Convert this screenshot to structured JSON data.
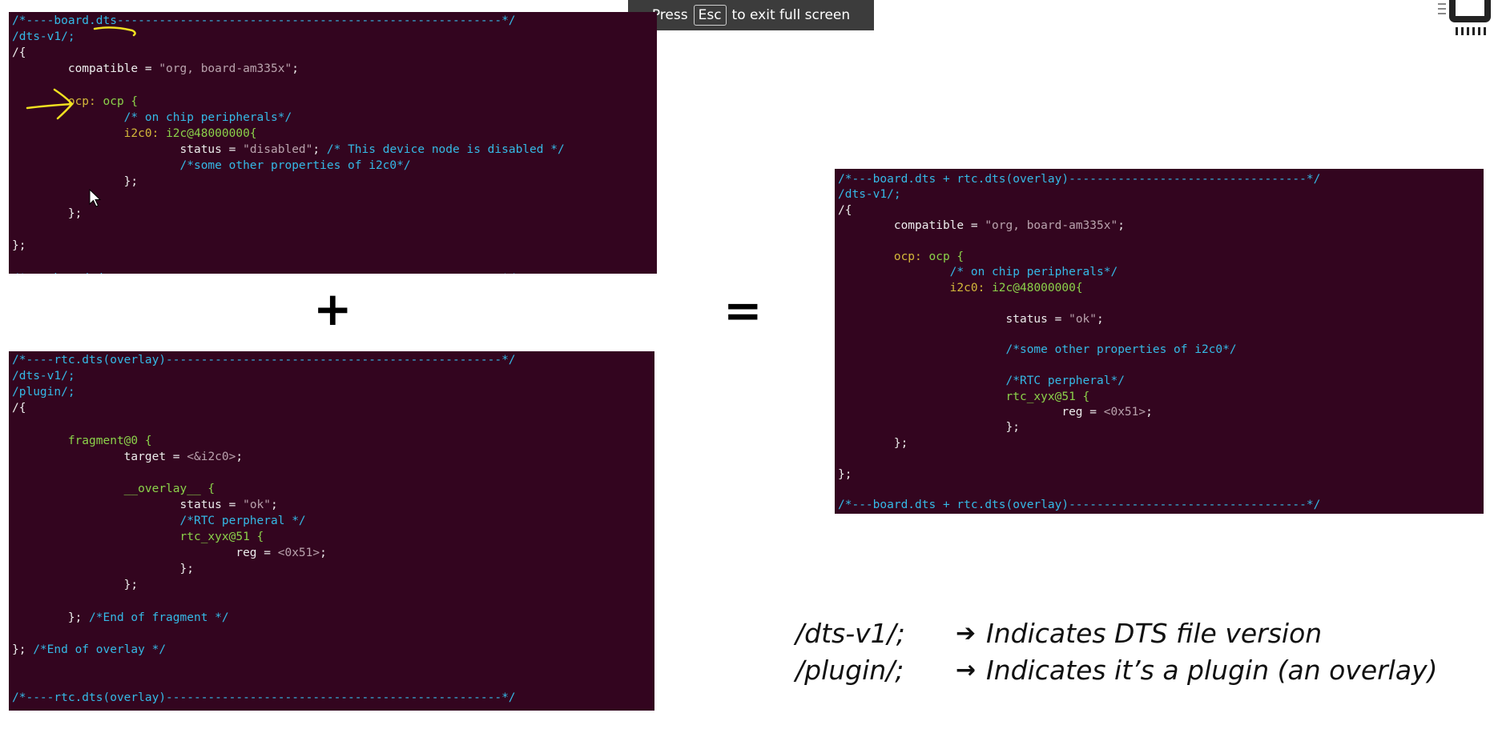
{
  "fullscreen_banner": {
    "press": "Press",
    "key": "Esc",
    "message": "to exit full screen"
  },
  "operators": {
    "plus": "+",
    "equals": "="
  },
  "board_dts": {
    "lines": [
      [
        {
          "t": "/*----board.dts-------------------------------------------------------*/",
          "c": "c"
        }
      ],
      [
        {
          "t": "/dts-v1/;",
          "c": "c"
        }
      ],
      [
        {
          "t": "/{",
          "c": "w"
        }
      ],
      [
        {
          "t": "        compatible = ",
          "c": "w"
        },
        {
          "t": "\"org, board-am335x\"",
          "c": "s"
        },
        {
          "t": ";",
          "c": "w"
        }
      ],
      [],
      [
        {
          "t": "        ocp: ",
          "c": "k"
        },
        {
          "t": "ocp {",
          "c": "g"
        }
      ],
      [
        {
          "t": "                /* on chip peripherals*/",
          "c": "c"
        }
      ],
      [
        {
          "t": "                i2c0: ",
          "c": "k"
        },
        {
          "t": "i2c@48000000{",
          "c": "g"
        }
      ],
      [
        {
          "t": "                        status = ",
          "c": "w"
        },
        {
          "t": "\"disabled\"",
          "c": "s"
        },
        {
          "t": "; ",
          "c": "w"
        },
        {
          "t": "/* This device node is disabled */",
          "c": "c"
        }
      ],
      [
        {
          "t": "                        /*some other properties of i2c0*/",
          "c": "c"
        }
      ],
      [
        {
          "t": "                };",
          "c": "w"
        }
      ],
      [],
      [
        {
          "t": "        };",
          "c": "w"
        }
      ],
      [],
      [
        {
          "t": "};",
          "c": "w"
        }
      ],
      [],
      [
        {
          "t": "/*----board.dts-------------------------------------------------------*/",
          "c": "c"
        }
      ]
    ]
  },
  "rtc_dts": {
    "lines": [
      [
        {
          "t": "/*----rtc.dts(overlay)------------------------------------------------*/",
          "c": "c"
        }
      ],
      [
        {
          "t": "/dts-v1/;",
          "c": "c"
        }
      ],
      [
        {
          "t": "/plugin/;",
          "c": "c"
        }
      ],
      [
        {
          "t": "/{",
          "c": "w"
        }
      ],
      [],
      [
        {
          "t": "        fragment@0 {",
          "c": "g"
        }
      ],
      [
        {
          "t": "                target = ",
          "c": "w"
        },
        {
          "t": "<&i2c0>",
          "c": "s"
        },
        {
          "t": ";",
          "c": "w"
        }
      ],
      [],
      [
        {
          "t": "                __overlay__ {",
          "c": "g"
        }
      ],
      [
        {
          "t": "                        status = ",
          "c": "w"
        },
        {
          "t": "\"ok\"",
          "c": "s"
        },
        {
          "t": ";",
          "c": "w"
        }
      ],
      [
        {
          "t": "                        /*RTC perpheral */",
          "c": "c"
        }
      ],
      [
        {
          "t": "                        rtc_xyx@51 {",
          "c": "g"
        }
      ],
      [
        {
          "t": "                                reg = ",
          "c": "w"
        },
        {
          "t": "<0x51>",
          "c": "s"
        },
        {
          "t": ";",
          "c": "w"
        }
      ],
      [
        {
          "t": "                        };",
          "c": "w"
        }
      ],
      [
        {
          "t": "                };",
          "c": "w"
        }
      ],
      [],
      [
        {
          "t": "        }; ",
          "c": "w"
        },
        {
          "t": "/*End of fragment */",
          "c": "c"
        }
      ],
      [],
      [
        {
          "t": "}; ",
          "c": "w"
        },
        {
          "t": "/*End of overlay */",
          "c": "c"
        }
      ],
      [],
      [],
      [
        {
          "t": "/*----rtc.dts(overlay)------------------------------------------------*/",
          "c": "c"
        }
      ]
    ]
  },
  "merged_dts": {
    "lines": [
      [
        {
          "t": "/*---board.dts + rtc.dts(overlay)----------------------------------*/",
          "c": "c"
        }
      ],
      [
        {
          "t": "/dts-v1/;",
          "c": "c"
        }
      ],
      [
        {
          "t": "/{",
          "c": "w"
        }
      ],
      [
        {
          "t": "        compatible = ",
          "c": "w"
        },
        {
          "t": "\"org, board-am335x\"",
          "c": "s"
        },
        {
          "t": ";",
          "c": "w"
        }
      ],
      [],
      [
        {
          "t": "        ocp: ",
          "c": "k"
        },
        {
          "t": "ocp {",
          "c": "g"
        }
      ],
      [
        {
          "t": "                /* on chip peripherals*/",
          "c": "c"
        }
      ],
      [
        {
          "t": "                i2c0: ",
          "c": "k"
        },
        {
          "t": "i2c@48000000{",
          "c": "g"
        }
      ],
      [],
      [
        {
          "t": "                        status = ",
          "c": "w"
        },
        {
          "t": "\"ok\"",
          "c": "s"
        },
        {
          "t": ";",
          "c": "w"
        }
      ],
      [],
      [
        {
          "t": "                        /*some other properties of i2c0*/",
          "c": "c"
        }
      ],
      [],
      [
        {
          "t": "                        /*RTC perpheral*/",
          "c": "c"
        }
      ],
      [
        {
          "t": "                        rtc_xyx@51 {",
          "c": "g"
        }
      ],
      [
        {
          "t": "                                reg = ",
          "c": "w"
        },
        {
          "t": "<0x51>",
          "c": "s"
        },
        {
          "t": ";",
          "c": "w"
        }
      ],
      [
        {
          "t": "                        };",
          "c": "w"
        }
      ],
      [
        {
          "t": "        };",
          "c": "w"
        }
      ],
      [],
      [
        {
          "t": "};",
          "c": "w"
        }
      ],
      [],
      [
        {
          "t": "/*---board.dts + rtc.dts(overlay)----------------------------------*/",
          "c": "c"
        }
      ]
    ]
  },
  "notes": [
    {
      "key": "/dts-v1/;",
      "arrow": "➔",
      "text": "Indicates DTS file version"
    },
    {
      "key": "/plugin/;",
      "arrow": "→",
      "text": "Indicates it’s a plugin (an overlay)"
    }
  ],
  "colors": {
    "terminal_bg": "#33051f",
    "comment": "#35b9e6",
    "label": "#d4b83a",
    "node": "#8bd24a",
    "string": "#b9a2ad",
    "annotation": "#f0e020"
  }
}
